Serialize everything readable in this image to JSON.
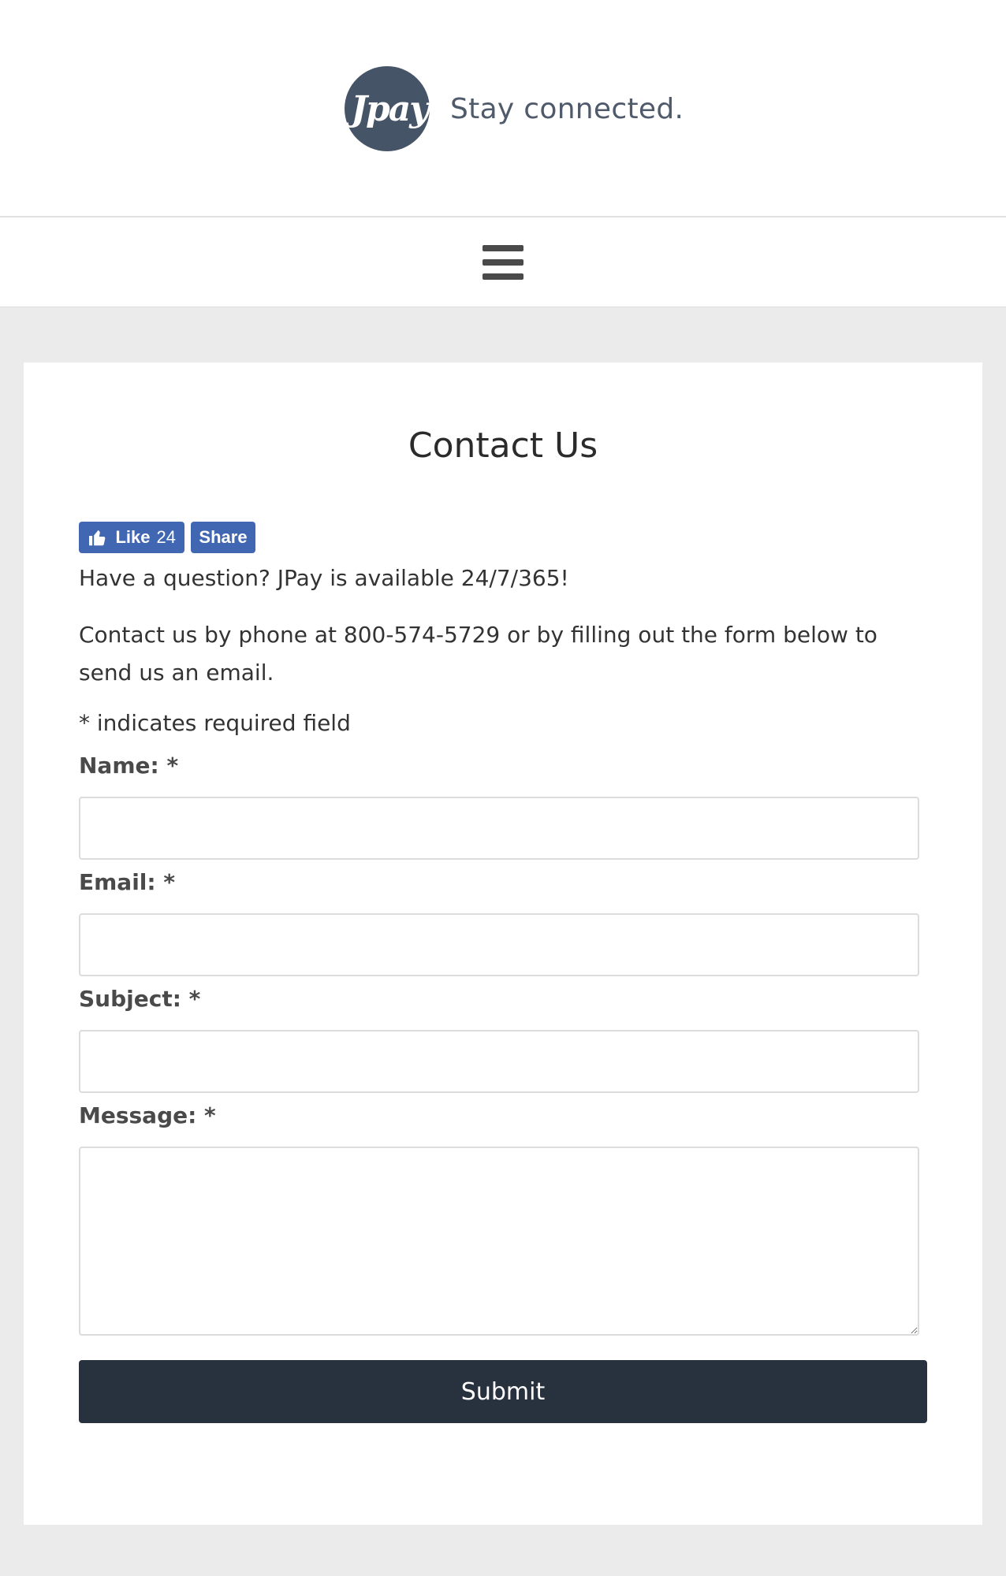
{
  "header": {
    "logo_text": "Jpay",
    "tagline": "Stay connected."
  },
  "nav": {
    "menu_icon": "hamburger-menu-icon"
  },
  "page": {
    "title": "Contact Us",
    "facebook": {
      "like_label": "Like",
      "like_count": "24",
      "share_label": "Share",
      "like_icon": "thumbs-up-icon",
      "color": "#4267b2"
    },
    "intro_line_1": "Have a question? JPay is available 24/7/365!",
    "intro_line_2": "Contact us by phone at 800-574-5729 or by filling out the form below to send us an email.",
    "required_note": "* indicates required field"
  },
  "form": {
    "name_label": "Name: *",
    "name_value": "",
    "email_label": "Email: *",
    "email_value": "",
    "subject_label": "Subject: *",
    "subject_value": "",
    "message_label": "Message: *",
    "message_value": "",
    "submit_label": "Submit"
  },
  "colors": {
    "background": "#ebebeb",
    "brand": "#465467",
    "submit_button": "#28323f"
  }
}
